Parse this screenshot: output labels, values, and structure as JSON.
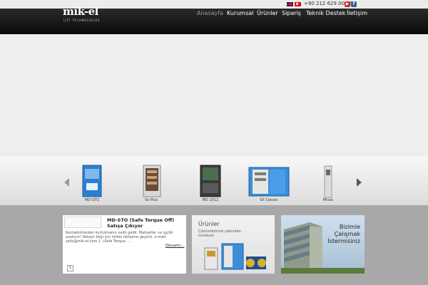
{
  "topbar": {
    "phone": "+90 212 629 00 08",
    "languages": [
      "en",
      "tr"
    ],
    "social": [
      "youtube-icon",
      "facebook-icon"
    ]
  },
  "logo": {
    "name": "mik-el",
    "tagline": "LIFT TECHNOLOGIES"
  },
  "nav": {
    "items": [
      "Anasayfa",
      "Kurumsal",
      "Ürünler",
      "Sipariş",
      "Teknik Destek",
      "İletişim"
    ],
    "active": "Anasayfa"
  },
  "carousel": {
    "items": [
      "MD-STO",
      "Sx Plus",
      "MD 2012",
      "SX Classic",
      "Mivox"
    ]
  },
  "news": {
    "title": "MD-STO (Safe Torque Off) Satışa Çıkıyor",
    "body": "Kontaktörlerden kurtulmanın vakti geldi. Maliyetler ve işçilik azalıyor! Detaylı bilgi için lütfen iletişime geçiniz. e-mail: satis@mik-el.com 1. (Safe Torque- ...",
    "more": "Devamı...",
    "page": "1"
  },
  "products_box": {
    "title": "Ürünler",
    "subtitle": "Çözümlerimizi yakından inceleyin"
  },
  "work_box": {
    "line1": "Bizimle",
    "line2": "Çalışmak",
    "line3": "İstermisiniz"
  },
  "colors": {
    "navbar": "#0a0a0a",
    "lower_bg": "#a8a8a8",
    "active_nav": "#9a9a9a"
  }
}
